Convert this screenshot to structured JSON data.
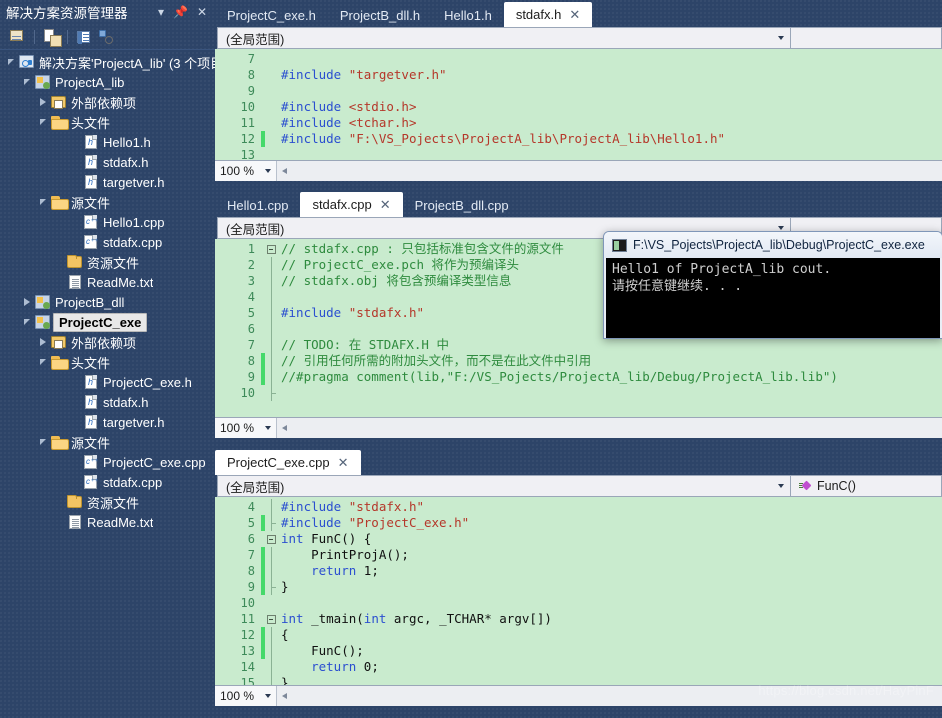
{
  "solution_explorer": {
    "title": "解决方案资源管理器",
    "title_buttons": [
      {
        "name": "dropdown",
        "glyph": "▾"
      },
      {
        "name": "pin",
        "glyph": "⇩"
      },
      {
        "name": "close",
        "glyph": "✕"
      }
    ],
    "toolbar": [
      {
        "name": "home-icon",
        "tip": "主页"
      },
      {
        "name": "show-all-files-icon",
        "tip": "显示所有文件"
      },
      {
        "name": "properties-icon",
        "tip": "属性"
      },
      {
        "name": "class-view-icon",
        "tip": "类视图"
      }
    ],
    "tree": [
      {
        "label": "解决方案'ProjectA_lib' (3 个项目",
        "icon": "solution-icon",
        "indent": 0,
        "expander": "open",
        "selected": false
      },
      {
        "label": "ProjectA_lib",
        "icon": "project-icon",
        "indent": 1,
        "expander": "open",
        "selected": false
      },
      {
        "label": "外部依赖项",
        "icon": "ref-folder-icon",
        "indent": 2,
        "expander": "closed",
        "selected": false
      },
      {
        "label": "头文件",
        "icon": "folder-open-icon",
        "indent": 2,
        "expander": "open",
        "selected": false
      },
      {
        "label": "Hello1.h",
        "icon": "header-file-icon",
        "indent": 4,
        "expander": "none",
        "selected": false
      },
      {
        "label": "stdafx.h",
        "icon": "header-file-icon",
        "indent": 4,
        "expander": "none",
        "selected": false
      },
      {
        "label": "targetver.h",
        "icon": "header-file-icon",
        "indent": 4,
        "expander": "none",
        "selected": false
      },
      {
        "label": "源文件",
        "icon": "folder-open-icon",
        "indent": 2,
        "expander": "open",
        "selected": false
      },
      {
        "label": "Hello1.cpp",
        "icon": "cpp-file-icon",
        "indent": 4,
        "expander": "none",
        "selected": false
      },
      {
        "label": "stdafx.cpp",
        "icon": "cpp-file-icon",
        "indent": 4,
        "expander": "none",
        "selected": false
      },
      {
        "label": "资源文件",
        "icon": "folder-closed-icon",
        "indent": 3,
        "expander": "none",
        "selected": false
      },
      {
        "label": "ReadMe.txt",
        "icon": "text-file-icon",
        "indent": 3,
        "expander": "none",
        "selected": false
      },
      {
        "label": "ProjectB_dll",
        "icon": "project-icon",
        "indent": 1,
        "expander": "closed",
        "selected": false
      },
      {
        "label": "ProjectC_exe",
        "icon": "project-icon",
        "indent": 1,
        "expander": "open",
        "selected": true
      },
      {
        "label": "外部依赖项",
        "icon": "ref-folder-icon",
        "indent": 2,
        "expander": "closed",
        "selected": false
      },
      {
        "label": "头文件",
        "icon": "folder-open-icon",
        "indent": 2,
        "expander": "open",
        "selected": false
      },
      {
        "label": "ProjectC_exe.h",
        "icon": "header-file-icon",
        "indent": 4,
        "expander": "none",
        "selected": false
      },
      {
        "label": "stdafx.h",
        "icon": "header-file-icon",
        "indent": 4,
        "expander": "none",
        "selected": false
      },
      {
        "label": "targetver.h",
        "icon": "header-file-icon",
        "indent": 4,
        "expander": "none",
        "selected": false
      },
      {
        "label": "源文件",
        "icon": "folder-open-icon",
        "indent": 2,
        "expander": "open",
        "selected": false
      },
      {
        "label": "ProjectC_exe.cpp",
        "icon": "cpp-file-icon",
        "indent": 4,
        "expander": "none",
        "selected": false
      },
      {
        "label": "stdafx.cpp",
        "icon": "cpp-file-icon",
        "indent": 4,
        "expander": "none",
        "selected": false
      },
      {
        "label": "资源文件",
        "icon": "folder-closed-icon",
        "indent": 3,
        "expander": "none",
        "selected": false
      },
      {
        "label": "ReadMe.txt",
        "icon": "text-file-icon",
        "indent": 3,
        "expander": "none",
        "selected": false
      }
    ]
  },
  "pane_top": {
    "tabs": [
      {
        "label": "ProjectC_exe.h",
        "active": false,
        "closable": false
      },
      {
        "label": "ProjectB_dll.h",
        "active": false,
        "closable": false
      },
      {
        "label": "Hello1.h",
        "active": false,
        "closable": false
      },
      {
        "label": "stdafx.h",
        "active": true,
        "closable": true
      }
    ],
    "scope": "(全局范围)",
    "member": "",
    "zoom": "100 %",
    "lines": [
      {
        "n": "7",
        "modified": false,
        "fold": "none",
        "segments": []
      },
      {
        "n": "8",
        "modified": false,
        "fold": "none",
        "segments": [
          {
            "t": "#include ",
            "c": "s-pre"
          },
          {
            "t": "\"targetver.h\"",
            "c": "s-str"
          }
        ]
      },
      {
        "n": "9",
        "modified": false,
        "fold": "none",
        "segments": []
      },
      {
        "n": "10",
        "modified": false,
        "fold": "none",
        "segments": [
          {
            "t": "#include ",
            "c": "s-pre"
          },
          {
            "t": "<stdio.h>",
            "c": "s-str"
          }
        ]
      },
      {
        "n": "11",
        "modified": false,
        "fold": "none",
        "segments": [
          {
            "t": "#include ",
            "c": "s-pre"
          },
          {
            "t": "<tchar.h>",
            "c": "s-str"
          }
        ]
      },
      {
        "n": "12",
        "modified": true,
        "fold": "none",
        "segments": [
          {
            "t": "#include ",
            "c": "s-pre"
          },
          {
            "t": "\"F:\\VS_Pojects\\ProjectA_lib\\ProjectA_lib\\Hello1.h\"",
            "c": "s-str"
          }
        ]
      },
      {
        "n": "13",
        "modified": false,
        "fold": "none",
        "segments": []
      }
    ]
  },
  "pane_middle": {
    "tabs": [
      {
        "label": "Hello1.cpp",
        "active": false,
        "closable": false
      },
      {
        "label": "stdafx.cpp",
        "active": true,
        "closable": true
      },
      {
        "label": "ProjectB_dll.cpp",
        "active": false,
        "closable": false
      }
    ],
    "scope": "(全局范围)",
    "member": "",
    "zoom": "100 %",
    "lines": [
      {
        "n": "1",
        "modified": false,
        "fold": "box",
        "segments": [
          {
            "t": "// stdafx.cpp : 只包括标准包含文件的源文件",
            "c": "s-cmt"
          }
        ]
      },
      {
        "n": "2",
        "modified": false,
        "fold": "line",
        "segments": [
          {
            "t": "// ProjectC_exe.pch 将作为预编译头",
            "c": "s-cmt"
          }
        ]
      },
      {
        "n": "3",
        "modified": false,
        "fold": "line",
        "segments": [
          {
            "t": "// stdafx.obj 将包含预编译类型信息",
            "c": "s-cmt"
          }
        ]
      },
      {
        "n": "4",
        "modified": false,
        "fold": "line",
        "segments": []
      },
      {
        "n": "5",
        "modified": false,
        "fold": "line",
        "segments": [
          {
            "t": "#include ",
            "c": "s-pre"
          },
          {
            "t": "\"stdafx.h\"",
            "c": "s-str"
          }
        ]
      },
      {
        "n": "6",
        "modified": false,
        "fold": "line",
        "segments": []
      },
      {
        "n": "7",
        "modified": false,
        "fold": "line",
        "segments": [
          {
            "t": "// TODO: 在 STDAFX.H 中",
            "c": "s-cmt"
          }
        ]
      },
      {
        "n": "8",
        "modified": true,
        "fold": "line",
        "segments": [
          {
            "t": "// 引用任何所需的附加头文件，而不是在此文件中引用",
            "c": "s-cmt"
          }
        ]
      },
      {
        "n": "9",
        "modified": true,
        "fold": "line",
        "segments": [
          {
            "t": "//#pragma comment(lib,\"F:/VS_Pojects/ProjectA_lib/Debug/ProjectA_lib.lib\")",
            "c": "s-cmt"
          }
        ]
      },
      {
        "n": "10",
        "modified": false,
        "fold": "end",
        "segments": []
      }
    ]
  },
  "pane_bottom": {
    "tabs": [
      {
        "label": "ProjectC_exe.cpp",
        "active": true,
        "closable": true
      }
    ],
    "scope": "(全局范围)",
    "member": "FunC()",
    "zoom": "100 %",
    "lines": [
      {
        "n": "4",
        "modified": false,
        "fold": "line",
        "segments": [
          {
            "t": "#include ",
            "c": "s-pre"
          },
          {
            "t": "\"stdafx.h\"",
            "c": "s-str"
          }
        ]
      },
      {
        "n": "5",
        "modified": true,
        "fold": "end",
        "segments": [
          {
            "t": "#include ",
            "c": "s-pre"
          },
          {
            "t": "\"ProjectC_exe.h\"",
            "c": "s-str"
          }
        ]
      },
      {
        "n": "6",
        "modified": false,
        "fold": "box",
        "segments": [
          {
            "t": "int",
            "c": "s-kw"
          },
          {
            "t": " FunC() {",
            "c": "s-txt"
          }
        ]
      },
      {
        "n": "7",
        "modified": true,
        "fold": "line",
        "segments": [
          {
            "t": "    PrintProjA();",
            "c": "s-txt"
          }
        ]
      },
      {
        "n": "8",
        "modified": true,
        "fold": "line",
        "segments": [
          {
            "t": "    ",
            "c": "s-txt"
          },
          {
            "t": "return",
            "c": "s-kw"
          },
          {
            "t": " 1;",
            "c": "s-txt"
          }
        ]
      },
      {
        "n": "9",
        "modified": true,
        "fold": "end",
        "segments": [
          {
            "t": "}",
            "c": "s-txt"
          }
        ]
      },
      {
        "n": "10",
        "modified": false,
        "fold": "none",
        "segments": []
      },
      {
        "n": "11",
        "modified": false,
        "fold": "box",
        "segments": [
          {
            "t": "int",
            "c": "s-kw"
          },
          {
            "t": " _tmain(",
            "c": "s-txt"
          },
          {
            "t": "int",
            "c": "s-kw"
          },
          {
            "t": " argc, ",
            "c": "s-txt"
          },
          {
            "t": "_TCHAR",
            "c": "s-txt"
          },
          {
            "t": "* argv[])",
            "c": "s-txt"
          }
        ]
      },
      {
        "n": "12",
        "modified": true,
        "fold": "line",
        "segments": [
          {
            "t": "{",
            "c": "s-txt"
          }
        ]
      },
      {
        "n": "13",
        "modified": true,
        "fold": "line",
        "segments": [
          {
            "t": "    FunC();",
            "c": "s-txt"
          }
        ]
      },
      {
        "n": "14",
        "modified": false,
        "fold": "line",
        "segments": [
          {
            "t": "    ",
            "c": "s-txt"
          },
          {
            "t": "return",
            "c": "s-kw"
          },
          {
            "t": " 0;",
            "c": "s-txt"
          }
        ]
      },
      {
        "n": "15",
        "modified": false,
        "fold": "line",
        "segments": [
          {
            "t": "}",
            "c": "s-txt"
          }
        ]
      }
    ]
  },
  "console_window": {
    "title": "F:\\VS_Pojects\\ProjectA_lib\\Debug\\ProjectC_exe.exe",
    "output": "Hello1 of ProjectA_lib cout.\n请按任意键继续. . ."
  },
  "watermark": "https://blog.csdn.net/HayPinF",
  "colors": {
    "chrome": "#2d4468",
    "editor_bg": "#c9ebce",
    "accent_tab": "#ffffff",
    "linenum": "#3d8a59",
    "comment": "#2e8b3e",
    "string": "#b5372a",
    "keyword": "#2b4fd0",
    "modified_bar": "#45d96a"
  }
}
